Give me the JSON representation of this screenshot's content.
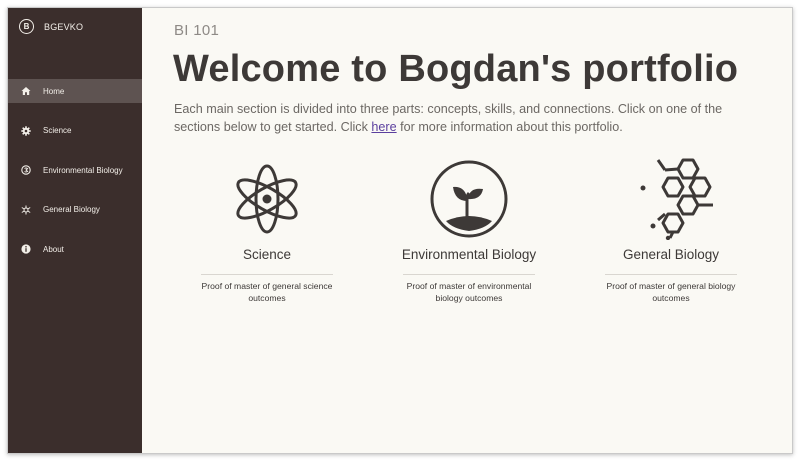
{
  "sidebar": {
    "brand_logo": "B",
    "brand_name": "BGEVKO",
    "items": [
      {
        "label": "Home",
        "icon": "home-icon",
        "active": true
      },
      {
        "label": "Science",
        "icon": "gear-icon",
        "active": false
      },
      {
        "label": "Environmental Biology",
        "icon": "leaf-icon",
        "active": false
      },
      {
        "label": "General Biology",
        "icon": "molecule-icon",
        "active": false
      },
      {
        "label": "About",
        "icon": "info-icon",
        "active": false
      }
    ]
  },
  "main": {
    "course": "BI 101",
    "title": "Welcome to Bogdan's portfolio",
    "intro_part1": "Each main section is divided into three parts: concepts, skills, and connections. Click on one of the sections below to get started. Click ",
    "intro_link": "here",
    "intro_part2": " for more information about this portfolio.",
    "cards": [
      {
        "title": "Science",
        "description": "Proof of master of general science outcomes",
        "icon": "atom-icon"
      },
      {
        "title": "Environmental Biology",
        "description": "Proof of master of environmental biology outcomes",
        "icon": "sprout-icon"
      },
      {
        "title": "General Biology",
        "description": "Proof of master of general biology outcomes",
        "icon": "hexagon-molecule-icon"
      }
    ]
  },
  "colors": {
    "sidebar_bg": "#3b2e2c",
    "sidebar_active": "#5e5351",
    "main_bg": "#faf9f4",
    "link": "#5b3f9e",
    "text_dark": "#3d3937"
  }
}
